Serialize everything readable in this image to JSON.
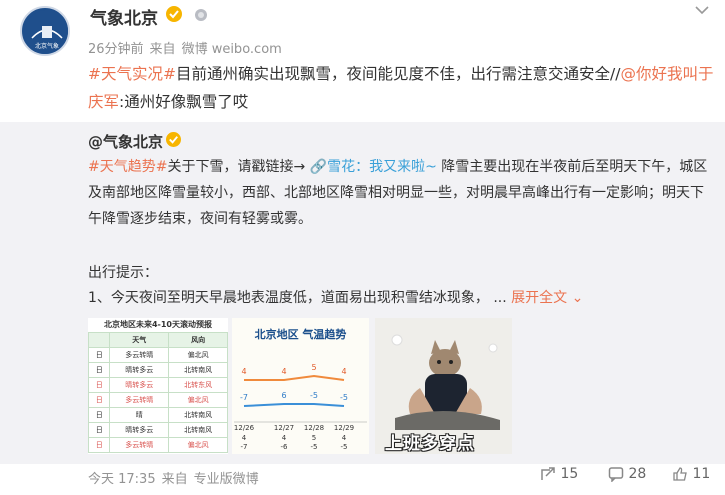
{
  "post": {
    "author": "气象北京",
    "time": "26分钟前",
    "from": "来自",
    "client": "微博 weibo.com",
    "text_parts": {
      "topic": "#天气实况#",
      "body": "目前通州确实出现飘雪，夜间能见度不佳，出行需注意交通安全//",
      "mention": "@你好我叫于庆军",
      "tail": ":通州好像飘雪了哎"
    }
  },
  "repost": {
    "author": "@气象北京",
    "topic": "#天气趋势#",
    "intro": "关于下雪，请戳链接→",
    "link": "雪花：我又来啦~",
    "body": "降雪主要出现在半夜前后至明天下午，城区及南部地区降雪量较小，西部、北部地区降雪相对明显一些，对明晨早高峰出行有一定影响；明天下午降雪逐步结束，夜间有轻雾或雾。",
    "tips_title": "出行提示：",
    "tip1": "1、今天夜间至明天早晨地表温度低，道面易出现积雪结冰现象，",
    "ellipsis": "...",
    "expand": "展开全文"
  },
  "images": {
    "table": {
      "title": "北京地区未来4-10天滚动预报",
      "headers": [
        "",
        "天气",
        "风向"
      ],
      "rows": [
        [
          "日",
          "多云转晴",
          "偏北风"
        ],
        [
          "日",
          "晴转多云",
          "北转南风"
        ],
        [
          "日",
          "晴转多云",
          "北转东风"
        ],
        [
          "日",
          "多云转晴",
          "偏北风"
        ],
        [
          "日",
          "晴",
          "北转南风"
        ],
        [
          "日",
          "晴转多云",
          "北转南风"
        ],
        [
          "日",
          "多云转晴",
          "偏北风"
        ]
      ]
    },
    "trend": {
      "title": "北京地区 气温趋势",
      "high_labels": [
        "4",
        "4",
        "5",
        "4"
      ],
      "low_labels": [
        "-7",
        "6",
        "-5",
        "-5"
      ],
      "dates": [
        "12/26",
        "12/27",
        "12/28",
        "12/29"
      ],
      "bottom_high": [
        "4",
        "4",
        "5",
        "4"
      ],
      "bottom_low": [
        "-7",
        "-6",
        "-5",
        "-5"
      ]
    },
    "cat": {
      "caption": "上班多穿点"
    }
  },
  "footer": {
    "time": "今天 17:35",
    "from": "来自",
    "client": "专业版微博",
    "reposts": "15",
    "comments": "28",
    "likes": "11"
  },
  "colors": {
    "link": "#eb7350",
    "repost_bg": "#f2f2f5",
    "meta": "#939393"
  }
}
